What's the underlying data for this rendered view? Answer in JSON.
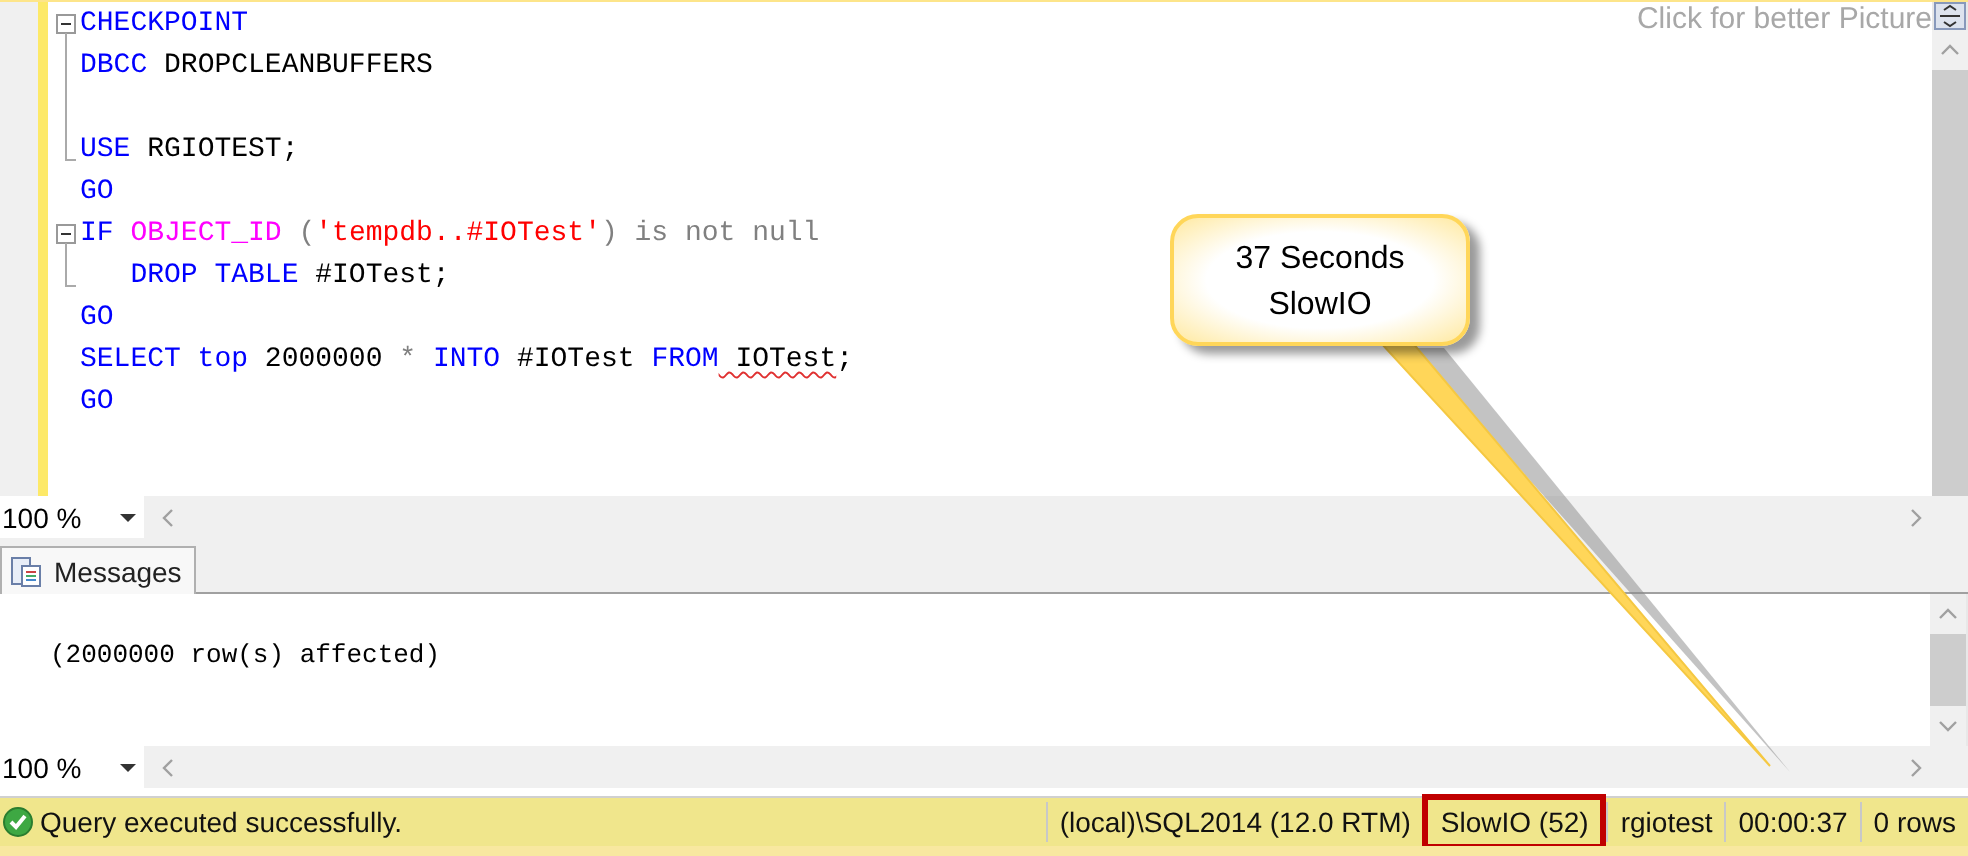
{
  "editor": {
    "caption": "Click for better Picture",
    "lines": [
      {
        "kind": "fold-start",
        "tokens": [
          {
            "kind": "keyword",
            "text": "CHECKPOINT"
          }
        ]
      },
      {
        "kind": "fold-inner",
        "tokens": [
          {
            "kind": "keyword",
            "text": "DBCC"
          },
          {
            "kind": "plain",
            "text": " DROPCLEANBUFFERS"
          }
        ]
      },
      {
        "kind": "fold-inner"
      },
      {
        "kind": "fold-end",
        "tokens": [
          {
            "kind": "keyword",
            "text": "USE"
          },
          {
            "kind": "plain",
            "text": " RGIOTEST;"
          }
        ]
      },
      {
        "kind": "plain",
        "tokens": [
          {
            "kind": "keyword",
            "text": "GO"
          }
        ]
      },
      {
        "kind": "fold-start",
        "tokens": [
          {
            "kind": "keyword",
            "text": "IF"
          },
          {
            "kind": "function",
            "text": " OBJECT_ID"
          },
          {
            "kind": "operator",
            "text": " ("
          },
          {
            "kind": "string",
            "text": "'tempdb..#IOTest'"
          },
          {
            "kind": "operator",
            "text": ") is not null"
          }
        ]
      },
      {
        "kind": "fold-end",
        "tokens": [
          {
            "kind": "keyword",
            "text": "   DROP TABLE"
          },
          {
            "kind": "plain",
            "text": " #IOTest;"
          }
        ]
      },
      {
        "kind": "plain",
        "tokens": [
          {
            "kind": "keyword",
            "text": "GO"
          }
        ]
      },
      {
        "kind": "plain",
        "tokens": [
          {
            "kind": "keyword",
            "text": "SELECT top"
          },
          {
            "kind": "plain",
            "text": " 2000000 "
          },
          {
            "kind": "operator",
            "text": "*"
          },
          {
            "kind": "keyword",
            "text": " INTO"
          },
          {
            "kind": "plain",
            "text": " #IOTest "
          },
          {
            "kind": "keyword",
            "text": "FROM"
          },
          {
            "kind": "plain",
            "text": " IOTest",
            "error": true
          },
          {
            "kind": "plain",
            "text": ";"
          }
        ]
      },
      {
        "kind": "plain",
        "tokens": [
          {
            "kind": "keyword",
            "text": "GO"
          }
        ]
      }
    ]
  },
  "editor_zoom": "100 %",
  "results": {
    "tabs": [
      {
        "label": "Messages",
        "selected": true
      }
    ],
    "message": "(2000000 row(s) affected)",
    "zoom": "100 %"
  },
  "callout": {
    "text": "37 Seconds\nSlowIO"
  },
  "status_bar": {
    "message": "Query executed successfully.",
    "items": [
      {
        "text": "(local)\\SQL2014 (12.0 RTM)",
        "highlighted": false
      },
      {
        "text": "SlowIO (52)",
        "highlighted": true
      },
      {
        "text": "rgiotest",
        "highlighted": false
      },
      {
        "text": "00:00:37",
        "highlighted": false
      },
      {
        "text": "0 rows",
        "highlighted": false
      }
    ]
  }
}
